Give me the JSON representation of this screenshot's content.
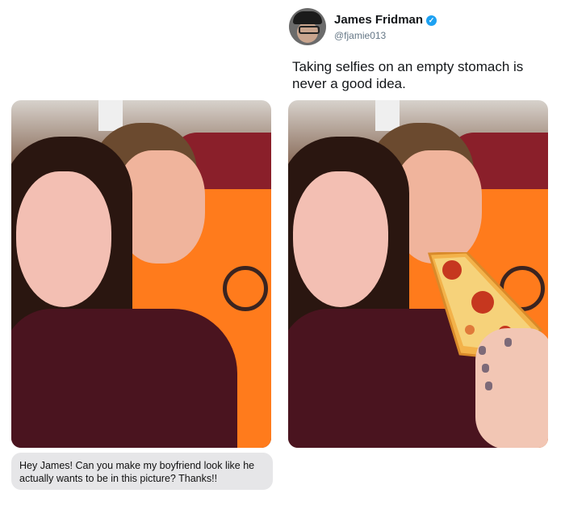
{
  "header": {
    "name": "James Fridman",
    "handle": "@fjamie013",
    "verified_color": "#1da1f2"
  },
  "tweet": {
    "text": "Taking selfies on an empty stomach is never a good idea."
  },
  "request_bubble": {
    "text": "Hey James! Can you make my boyfriend look like he actually wants to be in this picture? Thanks!!"
  },
  "icons": {
    "verified": "verified-badge-icon"
  }
}
